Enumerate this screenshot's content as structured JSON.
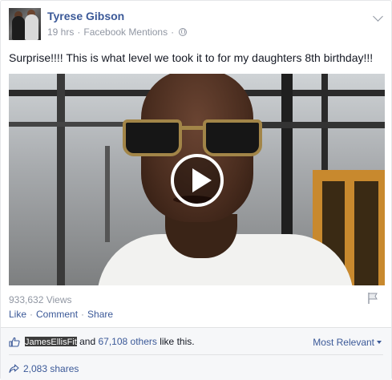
{
  "post": {
    "author": "Tyrese Gibson",
    "time": "19 hrs",
    "source": "Facebook Mentions",
    "text": "Surprise!!!! This is what level we took it to for my daughters 8th birthday!!!",
    "privacy_icon": "globe-icon",
    "options_icon": "chevron-down-icon"
  },
  "video": {
    "play_icon": "play-icon",
    "views": "933,632 Views"
  },
  "actions": {
    "like": "Like",
    "comment": "Comment",
    "share": "Share",
    "separator": "·"
  },
  "footer": {
    "liker_name": "JamesEllisFit",
    "likes_suffix_pre": " and ",
    "others": "67,108 others",
    "likes_suffix_post": " like this.",
    "sort": "Most Relevant",
    "shares": "2,083 shares"
  },
  "colors": {
    "link": "#3b5998",
    "muted": "#9197a3",
    "footer_bg": "#f6f7f9"
  }
}
